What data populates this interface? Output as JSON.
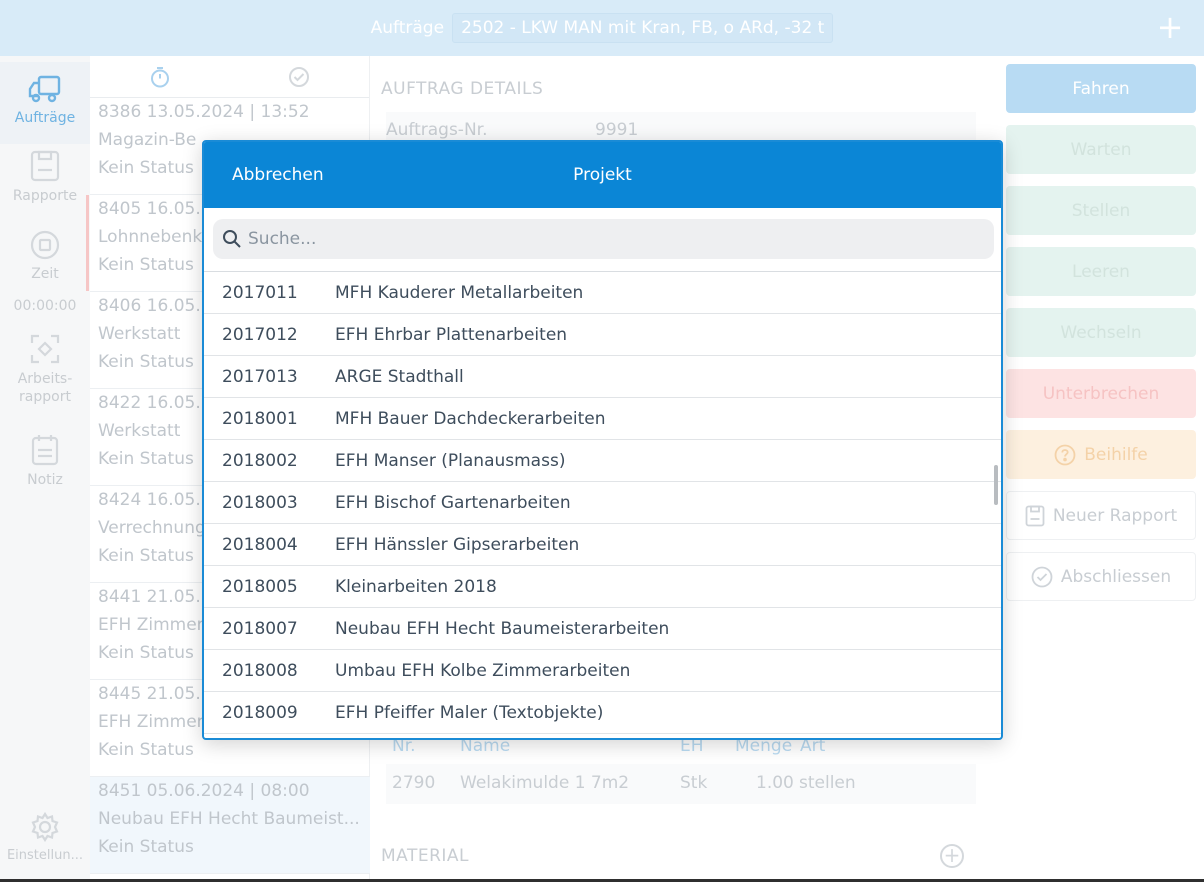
{
  "header": {
    "title": "Aufträge",
    "vehicle": "2502 - LKW MAN mit Kran, FB, o ARd, -32 t",
    "add_glyph": "+"
  },
  "nav": {
    "items": [
      {
        "label": "Aufträge",
        "icon": "truck-icon"
      },
      {
        "label": "Rapporte",
        "icon": "clipboard-icon"
      },
      {
        "label": "Zeit",
        "icon": "stop-circle-icon"
      },
      {
        "label": "Arbeits-",
        "label2": "rapport",
        "icon": "focus-icon"
      },
      {
        "label": "Notiz",
        "icon": "note-icon"
      },
      {
        "label": "Einstellun...",
        "icon": "gear-icon"
      }
    ],
    "time": "00:00:00"
  },
  "list": {
    "items": [
      {
        "line1": "8386  13.05.2024 | 13:52",
        "line2": "Magazin-Be",
        "line3": "Kein Status"
      },
      {
        "line1": "8405  16.05.",
        "line2": "Lohnnebenk",
        "line3": "Kein Status"
      },
      {
        "line1": "8406  16.05.",
        "line2": "Werkstatt",
        "line3": "Kein Status"
      },
      {
        "line1": "8422  16.05.",
        "line2": "Werkstatt",
        "line3": "Kein Status"
      },
      {
        "line1": "8424  16.05.",
        "line2": "Verrechnung",
        "line3": "Kein Status"
      },
      {
        "line1": "8441  21.05.",
        "line2": "EFH Zimmer",
        "line3": "Kein Status"
      },
      {
        "line1": "8445  21.05.",
        "line2": "EFH Zimmer",
        "line3": "Kein Status"
      },
      {
        "line1": "8451  05.06.2024 | 08:00",
        "line2": "Neubau EFH Hecht Baumeist...",
        "line3": "Kein Status"
      }
    ]
  },
  "details": {
    "section_title": "AUFTRAG DETAILS",
    "order_nr_label": "Auftrags-Nr.",
    "order_nr_value": "9991",
    "table_headers": {
      "nr": "Nr.",
      "name": "Name",
      "eh": "EH",
      "menge": "Menge",
      "art": "Art"
    },
    "table_row": {
      "nr": "2790",
      "name": "Welakimulde 1 7m2",
      "eh": "Stk",
      "menge": "1.00",
      "art": "stellen"
    },
    "material_title": "MATERIAL"
  },
  "actions": {
    "fahren": "Fahren",
    "warten": "Warten",
    "stellen": "Stellen",
    "leeren": "Leeren",
    "wechseln": "Wechseln",
    "unterbrechen": "Unterbrechen",
    "beihilfe": "Beihilfe",
    "neuer_rapport": "Neuer Rapport",
    "abschliessen": "Abschliessen"
  },
  "modal": {
    "cancel": "Abbrechen",
    "title": "Projekt",
    "search_placeholder": "Suche...",
    "rows": [
      {
        "nr": "2017011",
        "name": "MFH Kauderer Metallarbeiten"
      },
      {
        "nr": "2017012",
        "name": "EFH Ehrbar Plattenarbeiten"
      },
      {
        "nr": "2017013",
        "name": "ARGE Stadthall"
      },
      {
        "nr": "2018001",
        "name": "MFH Bauer Dachdeckerarbeiten"
      },
      {
        "nr": "2018002",
        "name": "EFH Manser (Planausmass)"
      },
      {
        "nr": "2018003",
        "name": "EFH Bischof Gartenarbeiten"
      },
      {
        "nr": "2018004",
        "name": "EFH Hänssler Gipserarbeiten"
      },
      {
        "nr": "2018005",
        "name": "Kleinarbeiten 2018"
      },
      {
        "nr": "2018007",
        "name": "Neubau EFH Hecht Baumeisterarbeiten"
      },
      {
        "nr": "2018008",
        "name": "Umbau EFH Kolbe Zimmerarbeiten"
      },
      {
        "nr": "2018009",
        "name": "EFH Pfeiffer Maler (Textobjekte)"
      }
    ]
  }
}
